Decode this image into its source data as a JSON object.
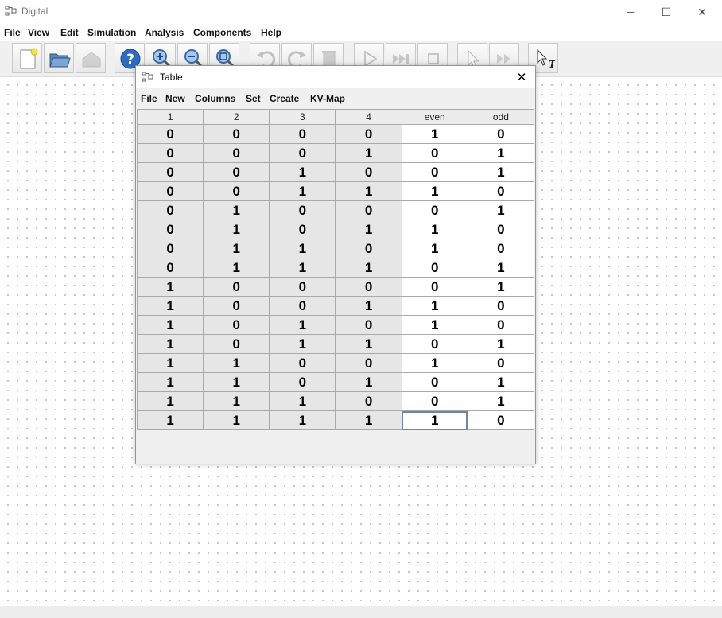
{
  "window": {
    "title": "Digital",
    "minimize": "─",
    "maximize": "☐",
    "close": "✕"
  },
  "menubar": [
    "File",
    "View",
    "Edit",
    "Simulation",
    "Analysis",
    "Components",
    "Help"
  ],
  "toolbar": [
    {
      "name": "new-icon",
      "enabled": true
    },
    {
      "name": "open-icon",
      "enabled": true
    },
    {
      "name": "save-icon",
      "enabled": false
    },
    {
      "name": "help-icon",
      "enabled": true
    },
    {
      "name": "zoom-in-icon",
      "enabled": true
    },
    {
      "name": "zoom-out-icon",
      "enabled": true
    },
    {
      "name": "zoom-fit-icon",
      "enabled": true
    },
    {
      "name": "undo-icon",
      "enabled": false
    },
    {
      "name": "redo-icon",
      "enabled": false
    },
    {
      "name": "delete-icon",
      "enabled": false
    },
    {
      "name": "run-icon",
      "enabled": false
    },
    {
      "name": "fast-forward-icon",
      "enabled": false
    },
    {
      "name": "stop-icon",
      "enabled": false
    },
    {
      "name": "select-icon",
      "enabled": false
    },
    {
      "name": "step-icon",
      "enabled": false
    },
    {
      "name": "text-pointer-icon",
      "enabled": true
    }
  ],
  "dialog": {
    "title": "Table",
    "close": "✕",
    "menu": [
      "File",
      "New",
      "Columns",
      "Set",
      "Create",
      "KV-Map"
    ],
    "columns": [
      "1",
      "2",
      "3",
      "4",
      "even",
      "odd"
    ],
    "input_columns": 4,
    "rows": [
      [
        "0",
        "0",
        "0",
        "0",
        "1",
        "0"
      ],
      [
        "0",
        "0",
        "0",
        "1",
        "0",
        "1"
      ],
      [
        "0",
        "0",
        "1",
        "0",
        "0",
        "1"
      ],
      [
        "0",
        "0",
        "1",
        "1",
        "1",
        "0"
      ],
      [
        "0",
        "1",
        "0",
        "0",
        "0",
        "1"
      ],
      [
        "0",
        "1",
        "0",
        "1",
        "1",
        "0"
      ],
      [
        "0",
        "1",
        "1",
        "0",
        "1",
        "0"
      ],
      [
        "0",
        "1",
        "1",
        "1",
        "0",
        "1"
      ],
      [
        "1",
        "0",
        "0",
        "0",
        "0",
        "1"
      ],
      [
        "1",
        "0",
        "0",
        "1",
        "1",
        "0"
      ],
      [
        "1",
        "0",
        "1",
        "0",
        "1",
        "0"
      ],
      [
        "1",
        "0",
        "1",
        "1",
        "0",
        "1"
      ],
      [
        "1",
        "1",
        "0",
        "0",
        "1",
        "0"
      ],
      [
        "1",
        "1",
        "0",
        "1",
        "0",
        "1"
      ],
      [
        "1",
        "1",
        "1",
        "0",
        "0",
        "1"
      ],
      [
        "1",
        "1",
        "1",
        "1",
        "1",
        "0"
      ]
    ],
    "selected_cell": {
      "row": 15,
      "col": 4
    }
  }
}
